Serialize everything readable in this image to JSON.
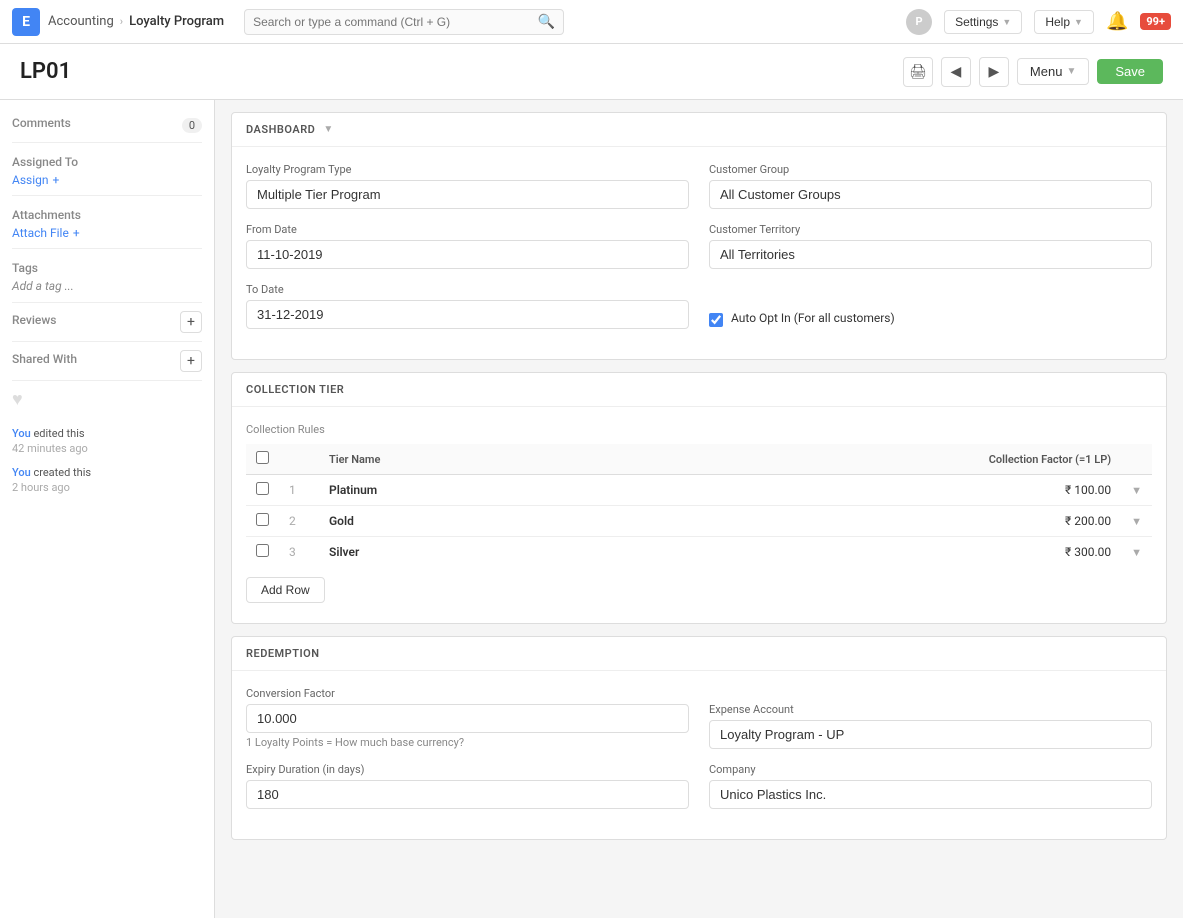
{
  "app": {
    "logo": "E",
    "breadcrumb": [
      "Accounting",
      "Loyalty Program"
    ],
    "search_placeholder": "Search or type a command (Ctrl + G)",
    "avatar": "P",
    "settings_label": "Settings",
    "help_label": "Help",
    "notifications": "99+"
  },
  "page": {
    "title": "LP01",
    "menu_label": "Menu",
    "save_label": "Save"
  },
  "sidebar": {
    "comments_label": "Comments",
    "comments_count": "0",
    "assigned_to_label": "Assigned To",
    "assign_label": "Assign",
    "attachments_label": "Attachments",
    "attach_file_label": "Attach File",
    "tags_label": "Tags",
    "add_tag_label": "Add a tag ...",
    "reviews_label": "Reviews",
    "shared_with_label": "Shared With",
    "activity": [
      {
        "who": "You",
        "action": "edited this",
        "when": "42 minutes ago"
      },
      {
        "who": "You",
        "action": "created this",
        "when": "2 hours ago"
      }
    ]
  },
  "dashboard": {
    "section_label": "DASHBOARD",
    "loyalty_program_type_label": "Loyalty Program Type",
    "loyalty_program_type_value": "Multiple Tier Program",
    "customer_group_label": "Customer Group",
    "customer_group_value": "All Customer Groups",
    "from_date_label": "From Date",
    "from_date_value": "11-10-2019",
    "customer_territory_label": "Customer Territory",
    "customer_territory_value": "All Territories",
    "to_date_label": "To Date",
    "to_date_value": "31-12-2019",
    "auto_opt_in_label": "Auto Opt In (For all customers)",
    "collection_tier_label": "COLLECTION TIER",
    "collection_rules_label": "Collection Rules",
    "table_headers": [
      "Tier Name",
      "Collection Factor (=1 LP)"
    ],
    "tiers": [
      {
        "num": "1",
        "name": "Platinum",
        "factor": "₹ 100.00"
      },
      {
        "num": "2",
        "name": "Gold",
        "factor": "₹ 200.00"
      },
      {
        "num": "3",
        "name": "Silver",
        "factor": "₹ 300.00"
      }
    ],
    "add_row_label": "Add Row",
    "redemption_label": "REDEMPTION",
    "conversion_factor_label": "Conversion Factor",
    "conversion_factor_value": "10.000",
    "conversion_hint": "1 Loyalty Points = How much base currency?",
    "expense_account_label": "Expense Account",
    "expense_account_value": "Loyalty Program - UP",
    "expiry_duration_label": "Expiry Duration (in days)",
    "expiry_duration_value": "180",
    "company_label": "Company",
    "company_value": "Unico Plastics Inc."
  }
}
